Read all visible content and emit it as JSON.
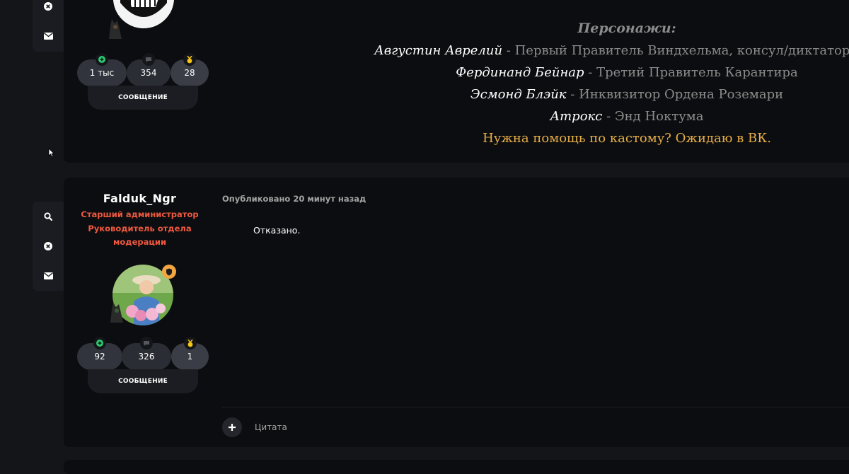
{
  "post1": {
    "stats": [
      {
        "icon": "plus-circle-icon",
        "value": "1 тыс"
      },
      {
        "icon": "comment-icon",
        "value": "354"
      },
      {
        "icon": "medal-icon",
        "value": "28"
      }
    ],
    "message_button": "СООБЩЕНИЕ",
    "signature": {
      "heading": "Персонажи:",
      "characters": [
        {
          "name": "Августин Аврелий",
          "desc": " - Первый Правитель Виндхельма, консул/диктатор Лат"
        },
        {
          "name": "Фердинанд Бейнар",
          "desc": " - Третий Правитель Карантира"
        },
        {
          "name": "Эсмонд Блэйк",
          "desc": " - Инквизитор Ордена Роземари"
        },
        {
          "name": "Атрокс",
          "desc": " - Энд Ноктума"
        }
      ],
      "help": "Нужна помощь по кастому? Ожидаю в ВК."
    }
  },
  "post2": {
    "username": "Falduk_Ngr",
    "titles": [
      "Старший администратор",
      "Руководитель отдела",
      "модерации"
    ],
    "stats": [
      {
        "icon": "plus-circle-icon",
        "value": "92"
      },
      {
        "icon": "comment-icon",
        "value": "326"
      },
      {
        "icon": "medal-icon",
        "value": "1"
      }
    ],
    "message_button": "СООБЩЕНИЕ",
    "date": "Опубликовано 20 минут назад",
    "content": "Отказано.",
    "quote_label": "Цитата"
  },
  "colors": {
    "background": "#141519",
    "post_bg": "#0c0d10",
    "title_red": "#f0593f",
    "help_yellow": "#e5ad46",
    "stat_green": "#2ecc71",
    "medal_yellow": "#f5c518"
  }
}
